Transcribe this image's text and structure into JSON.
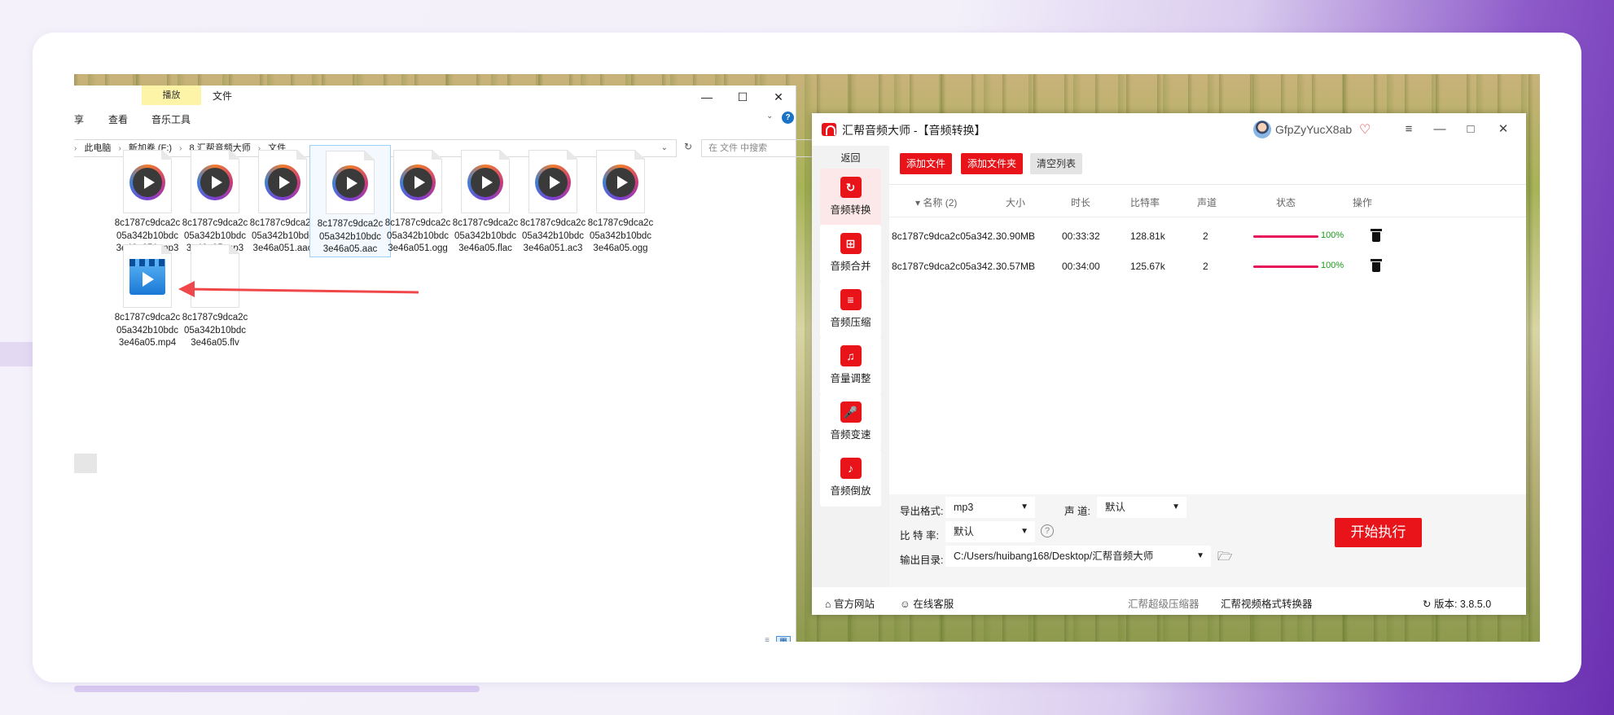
{
  "explorer": {
    "ribbon_tab_play": "播放",
    "ribbon_tab_file": "文件",
    "tabs": [
      "享",
      "查看",
      "音乐工具"
    ],
    "breadcrumb": [
      "此电脑",
      "新加卷 (F:)",
      "8.汇帮音频大师",
      "文件"
    ],
    "search_placeholder": "在 文件 中搜索",
    "files": [
      {
        "name": [
          "8c1787c9dca2c",
          "05a342b10bdc",
          "3e46a051.mp3"
        ],
        "icon": "audio-play-icon"
      },
      {
        "name": [
          "8c1787c9dca2c",
          "05a342b10bdc",
          "3e46a05.mp3"
        ],
        "icon": "audio-play-icon"
      },
      {
        "name": [
          "8c1787c9dca2c",
          "05a342b10bdc",
          "3e46a051.aac"
        ],
        "icon": "audio-play-icon"
      },
      {
        "name": [
          "8c1787c9dca2c",
          "05a342b10bdc",
          "3e46a05.aac"
        ],
        "icon": "audio-play-icon",
        "selected": true
      },
      {
        "name": [
          "8c1787c9dca2c",
          "05a342b10bdc",
          "3e46a051.ogg"
        ],
        "icon": "audio-play-icon"
      },
      {
        "name": [
          "8c1787c9dca2c",
          "05a342b10bdc",
          "3e46a05.flac"
        ],
        "icon": "audio-play-icon"
      },
      {
        "name": [
          "8c1787c9dca2c",
          "05a342b10bdc",
          "3e46a051.ac3"
        ],
        "icon": "audio-play-icon"
      },
      {
        "name": [
          "8c1787c9dca2c",
          "05a342b10bdc",
          "3e46a05.ogg"
        ],
        "icon": "audio-play-icon"
      },
      {
        "name": [
          "8c1787c9dca2c",
          "05a342b10bdc",
          "3e46a05.mp4"
        ],
        "icon": "video-file-icon"
      },
      {
        "name": [
          "8c1787c9dca2c",
          "05a342b10bdc",
          "3e46a05.flv"
        ],
        "icon": "blank-file-icon"
      }
    ],
    "arrow_color": "#f0484a"
  },
  "app": {
    "title": "汇帮音频大师 -【音频转换】",
    "username": "GfpZyYucX8ab",
    "back": "返回",
    "sidebar": [
      {
        "label": "音频转换",
        "icon": "audio-convert-icon",
        "active": true
      },
      {
        "label": "音频合并",
        "icon": "audio-merge-icon"
      },
      {
        "label": "音频压缩",
        "icon": "audio-compress-icon"
      },
      {
        "label": "音量调整",
        "icon": "volume-icon"
      },
      {
        "label": "音频变速",
        "icon": "microphone-icon"
      },
      {
        "label": "音频倒放",
        "icon": "music-note-icon"
      }
    ],
    "toolbar": {
      "add_file": "添加文件",
      "add_folder": "添加文件夹",
      "clear": "清空列表"
    },
    "columns": [
      "名称 (2)",
      "大小",
      "时长",
      "比特率",
      "声道",
      "状态",
      "操作"
    ],
    "rows": [
      {
        "name": "8c1787c9dca2c05a342...",
        "size": "30.90MB",
        "duration": "00:33:32",
        "bitrate": "128.81k",
        "channels": "2",
        "progress": "100%"
      },
      {
        "name": "8c1787c9dca2c05a342...",
        "size": "30.57MB",
        "duration": "00:34:00",
        "bitrate": "125.67k",
        "channels": "2",
        "progress": "100%"
      }
    ],
    "settings": {
      "format_label": "导出格式:",
      "format_value": "mp3",
      "channel_label": "声 道:",
      "channel_value": "默认",
      "bitrate_label": "比 特 率:",
      "bitrate_value": "默认",
      "output_label": "输出目录:",
      "output_value": "C:/Users/huibang168/Desktop/汇帮音频大师",
      "start": "开始执行"
    },
    "statusbar": {
      "website": "官方网站",
      "support": "在线客服",
      "link1": "汇帮超级压缩器",
      "link2": "汇帮视频格式转换器",
      "version": "版本: 3.8.5.0"
    },
    "accent": "#e8141a"
  }
}
